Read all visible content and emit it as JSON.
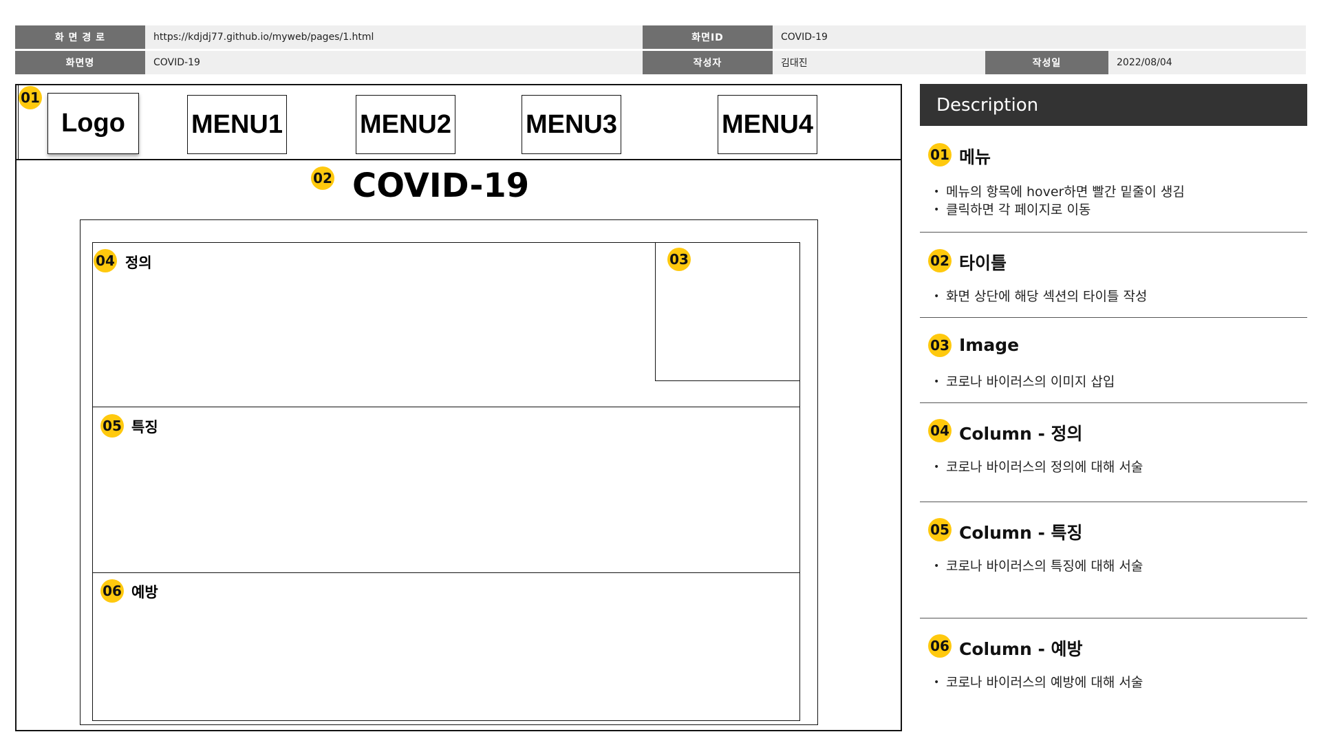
{
  "header": {
    "path_label": "화 면 경 로",
    "path_value": "https://kdjdj77.github.io/myweb/pages/1.html",
    "screen_id_label": "화면ID",
    "screen_id_value": "COVID-19",
    "screen_name_label": "화면명",
    "screen_name_value": "COVID-19",
    "author_label": "작성자",
    "author_value": "김대진",
    "date_label": "작성일",
    "date_value": "2022/08/04"
  },
  "wireframe": {
    "logo": "Logo",
    "menus": [
      "MENU1",
      "MENU2",
      "MENU3",
      "MENU4"
    ],
    "title": "COVID-19",
    "badges": [
      "01",
      "02",
      "03",
      "04",
      "05",
      "06"
    ],
    "columns": [
      "정의",
      "특징",
      "예방"
    ]
  },
  "description": {
    "header": "Description",
    "sections": [
      {
        "num": "01",
        "title": "메뉴",
        "items": [
          "메뉴의 항목에 hover하면 빨간 밑줄이 생김",
          "클릭하면 각 페이지로 이동"
        ]
      },
      {
        "num": "02",
        "title": "타이틀",
        "items": [
          "화면 상단에 해당 섹션의 타이틀 작성"
        ]
      },
      {
        "num": "03",
        "title": "Image",
        "items": [
          "코로나 바이러스의 이미지 삽입"
        ]
      },
      {
        "num": "04",
        "title": "Column - 정의",
        "items": [
          "코로나 바이러스의 정의에 대해 서술"
        ]
      },
      {
        "num": "05",
        "title": "Column - 특징",
        "items": [
          "코로나 바이러스의 특징에 대해 서술"
        ]
      },
      {
        "num": "06",
        "title": "Column - 예방",
        "items": [
          "코로나 바이러스의 예방에 대해 서술"
        ]
      }
    ]
  },
  "colors": {
    "label_bg": "#6f6f6f",
    "value_bg": "#efefef",
    "badge": "#ffc90e",
    "desc_header": "#333333"
  }
}
